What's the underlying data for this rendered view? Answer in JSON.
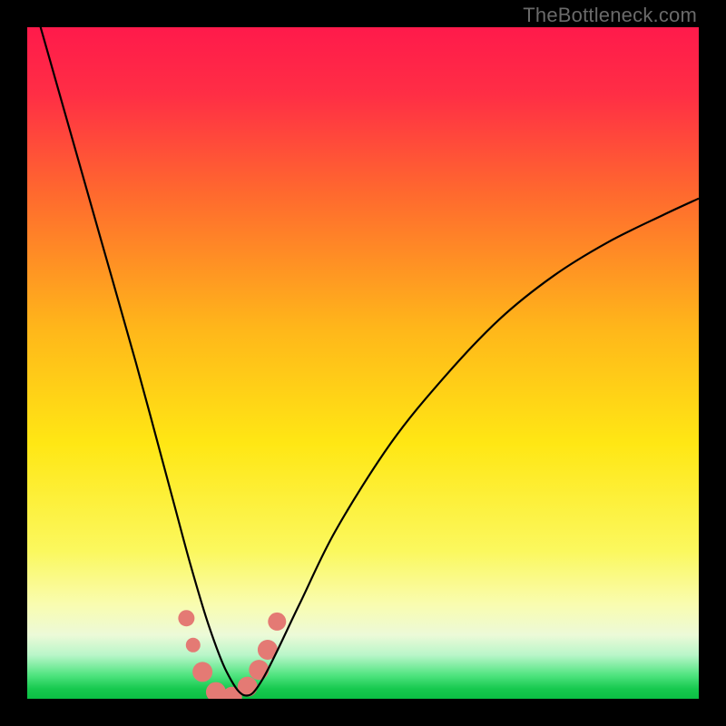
{
  "watermark": "TheBottleneck.com",
  "chart_data": {
    "type": "line",
    "title": "",
    "xlabel": "",
    "ylabel": "",
    "xlim": [
      0,
      1
    ],
    "ylim": [
      0,
      100
    ],
    "gradient_stops": [
      {
        "offset": 0.0,
        "color": "#ff1a4b"
      },
      {
        "offset": 0.1,
        "color": "#ff2e45"
      },
      {
        "offset": 0.25,
        "color": "#ff6a2e"
      },
      {
        "offset": 0.45,
        "color": "#ffb71a"
      },
      {
        "offset": 0.62,
        "color": "#ffe714"
      },
      {
        "offset": 0.78,
        "color": "#fbf85e"
      },
      {
        "offset": 0.86,
        "color": "#f9fcb0"
      },
      {
        "offset": 0.905,
        "color": "#ecfad8"
      },
      {
        "offset": 0.935,
        "color": "#b9f6c9"
      },
      {
        "offset": 0.965,
        "color": "#4fe47f"
      },
      {
        "offset": 0.985,
        "color": "#17c94f"
      },
      {
        "offset": 1.0,
        "color": "#0bbf44"
      }
    ],
    "series": [
      {
        "name": "bottleneck-curve",
        "x": [
          0.0,
          0.054,
          0.108,
          0.162,
          0.216,
          0.243,
          0.27,
          0.297,
          0.324,
          0.351,
          0.405,
          0.459,
          0.541,
          0.622,
          0.703,
          0.784,
          0.865,
          0.946,
          1.0
        ],
        "y": [
          107.0,
          88.0,
          69.0,
          50.0,
          30.0,
          20.0,
          11.0,
          4.0,
          0.5,
          3.0,
          14.0,
          25.0,
          38.0,
          48.0,
          56.5,
          63.0,
          68.0,
          72.0,
          74.5
        ]
      }
    ],
    "markers": {
      "name": "highlight-dots",
      "color": "#e47a74",
      "points": [
        {
          "x": 0.237,
          "y": 12.0,
          "r": 9
        },
        {
          "x": 0.247,
          "y": 8.0,
          "r": 8
        },
        {
          "x": 0.261,
          "y": 4.0,
          "r": 11
        },
        {
          "x": 0.281,
          "y": 1.0,
          "r": 11
        },
        {
          "x": 0.305,
          "y": 0.3,
          "r": 11
        },
        {
          "x": 0.328,
          "y": 1.8,
          "r": 11
        },
        {
          "x": 0.345,
          "y": 4.3,
          "r": 11
        },
        {
          "x": 0.358,
          "y": 7.3,
          "r": 11
        },
        {
          "x": 0.372,
          "y": 11.5,
          "r": 10
        }
      ]
    }
  }
}
